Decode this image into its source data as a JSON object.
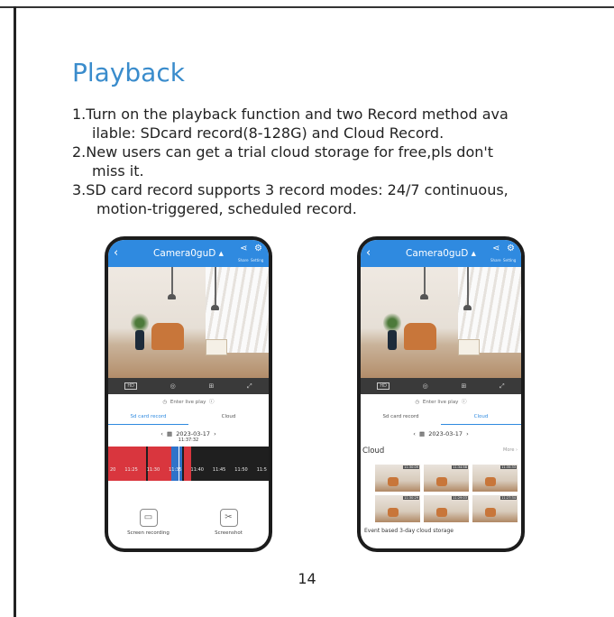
{
  "page": {
    "title": "Playback",
    "steps": [
      {
        "line1": "1.Turn on the playback function and two Record method ava",
        "line2": "ilable: SDcard record(8-128G) and Cloud Record."
      },
      {
        "line1": "2.New users can get a trial cloud storage for free,pls don't",
        "line2": "miss it."
      },
      {
        "line1": "3.SD card record supports 3 record modes: 24/7 continuous,",
        "line2": "motion-triggered, scheduled record."
      }
    ],
    "page_number": "14"
  },
  "phone_left": {
    "camera": "Camera0guD",
    "share_label": "Share",
    "setting_label": "Setting",
    "hd": "HD",
    "enter_live": "Enter live play",
    "tab_sd": "Sd card record",
    "tab_cloud": "Cloud",
    "date": "2023-03-17",
    "time": "11:37:32",
    "ticks": [
      "20",
      "11:25",
      "11:30",
      "11:35",
      "11:40",
      "11:45",
      "11:50",
      "11:5"
    ],
    "btn_record": "Screen recording",
    "btn_shot": "Screenshot"
  },
  "phone_right": {
    "camera": "Camera0guD",
    "share_label": "Share",
    "setting_label": "Setting",
    "hd": "HD",
    "enter_live": "Enter live play",
    "tab_sd": "Sd card record",
    "tab_cloud": "Cloud",
    "date": "2023-03-17",
    "cloud_label": "Cloud",
    "more": "More",
    "thumb_times": [
      "11:30:09",
      "11:34:58",
      "11:35:33",
      "11:30:29",
      "11:29:03",
      "11:27:34"
    ],
    "footer": "Event based 3-day cloud storage"
  },
  "colors": {
    "title": "#3a8ccc",
    "app_blue": "#2f8ae0",
    "timeline_red": "#d9363e"
  }
}
